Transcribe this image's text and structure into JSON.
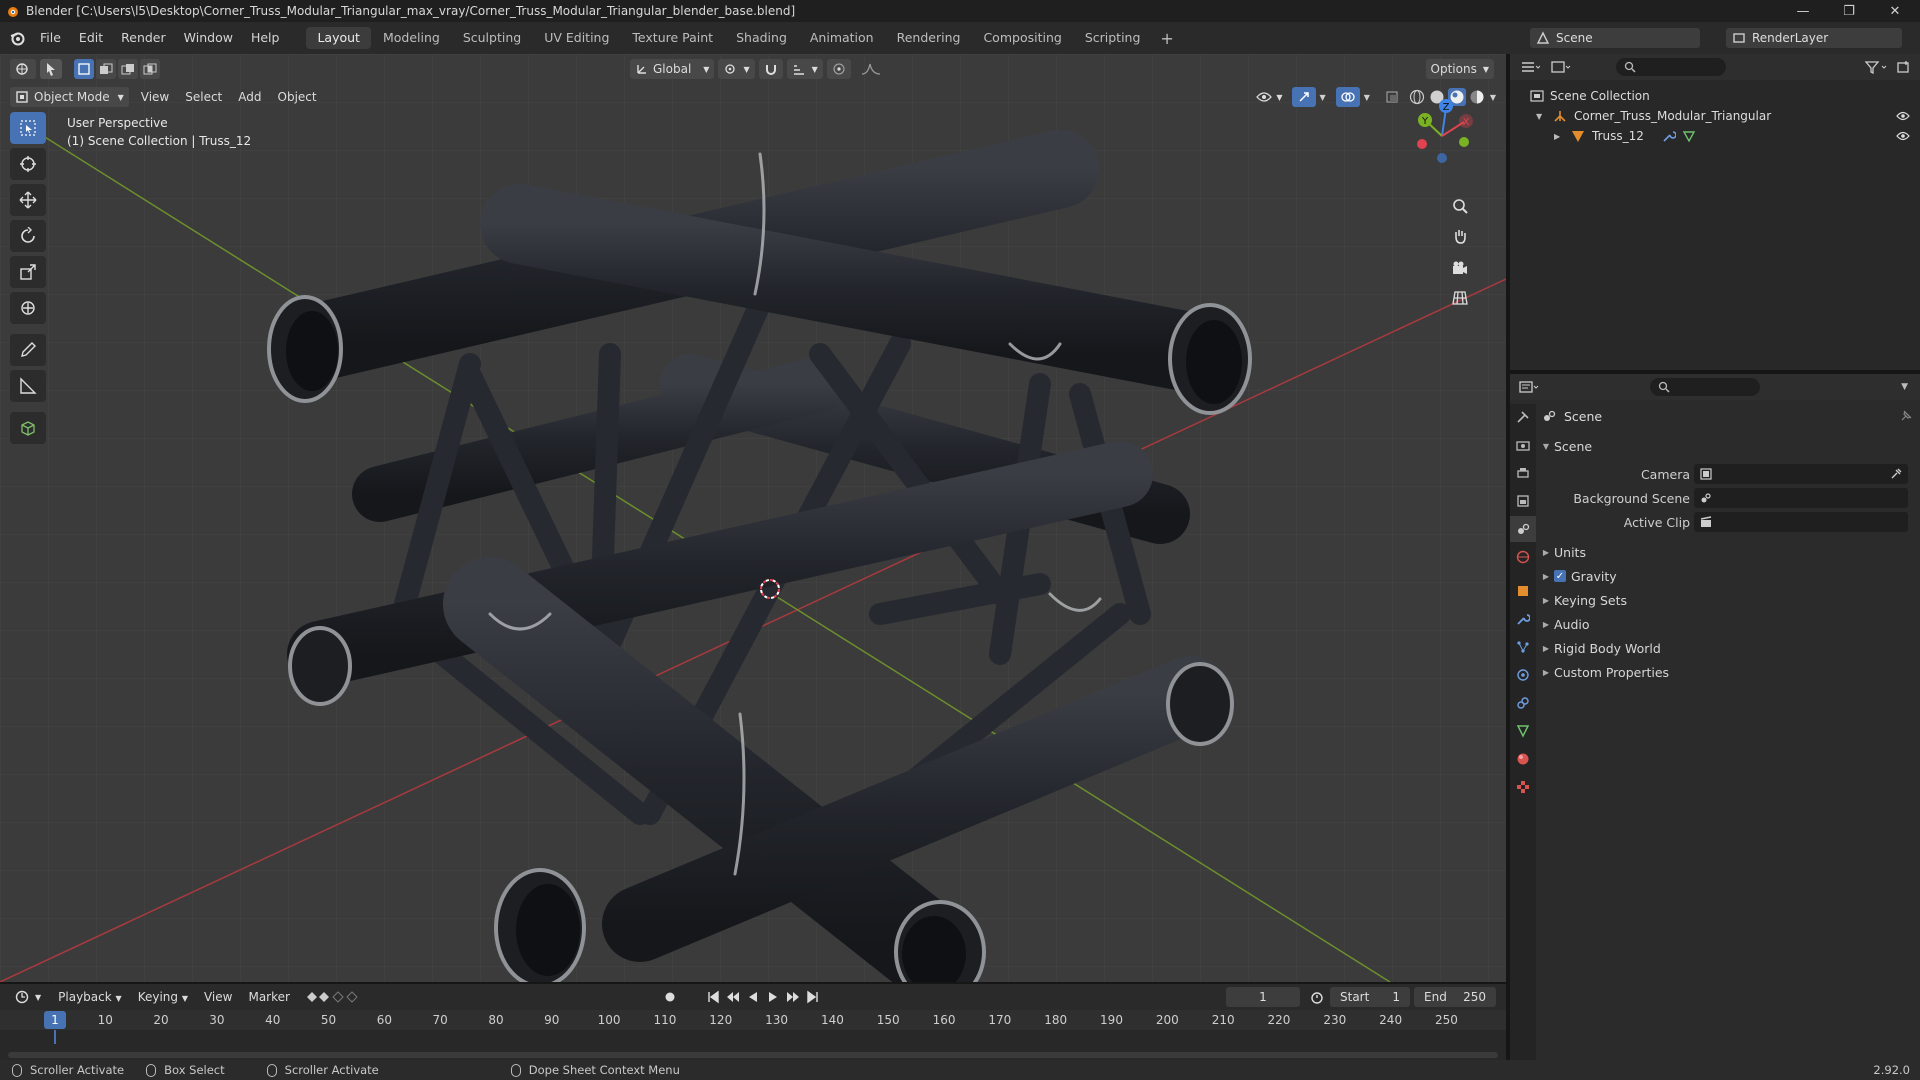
{
  "window": {
    "title": "Blender [C:\\Users\\l5\\Desktop\\Corner_Truss_Modular_Triangular_max_vray/Corner_Truss_Modular_Triangular_blender_base.blend]",
    "minimize": "—",
    "maximize": "❐",
    "close": "✕"
  },
  "menu": [
    "File",
    "Edit",
    "Render",
    "Window",
    "Help"
  ],
  "workspaces": [
    "Layout",
    "Modeling",
    "Sculpting",
    "UV Editing",
    "Texture Paint",
    "Shading",
    "Animation",
    "Rendering",
    "Compositing",
    "Scripting"
  ],
  "workspace_add": "+",
  "scene_field": "Scene",
  "renderlayer_field": "RenderLayer",
  "viewport": {
    "transform_orientation": "Global",
    "options_label": "Options",
    "mode": "Object Mode",
    "menus": [
      "View",
      "Select",
      "Add",
      "Object"
    ],
    "overlay_line1": "User Perspective",
    "overlay_line2": "(1) Scene Collection | Truss_12",
    "gizmo": {
      "x": "X",
      "y": "Y",
      "z": "Z"
    }
  },
  "outliner": {
    "root": "Scene Collection",
    "items": [
      {
        "name": "Corner_Truss_Modular_Triangular"
      },
      {
        "name": "Truss_12"
      }
    ]
  },
  "properties": {
    "context": "Scene",
    "panel": "Scene",
    "fields": [
      {
        "label": "Camera"
      },
      {
        "label": "Background Scene"
      },
      {
        "label": "Active Clip"
      }
    ],
    "subpanels": [
      "Units",
      "Gravity",
      "Keying Sets",
      "Audio",
      "Rigid Body World",
      "Custom Properties"
    ],
    "gravity_checked": true
  },
  "timeline": {
    "menus": [
      "Playback",
      "Keying",
      "View",
      "Marker"
    ],
    "current_frame": "1",
    "start_label": "Start",
    "start_value": "1",
    "end_label": "End",
    "end_value": "250",
    "ruler": [
      "1",
      "10",
      "20",
      "30",
      "40",
      "50",
      "60",
      "70",
      "80",
      "90",
      "100",
      "110",
      "120",
      "130",
      "140",
      "150",
      "160",
      "170",
      "180",
      "190",
      "200",
      "210",
      "220",
      "230",
      "240",
      "250"
    ]
  },
  "status": {
    "items": [
      "Scroller Activate",
      "Box Select",
      "Scroller Activate",
      "Dope Sheet Context Menu"
    ],
    "version": "2.92.0"
  },
  "colors": {
    "accent": "#4772b3",
    "axis_x": "#e0434f",
    "axis_y": "#7bb224",
    "axis_z": "#3f84e6",
    "orange": "#e38d2f"
  }
}
